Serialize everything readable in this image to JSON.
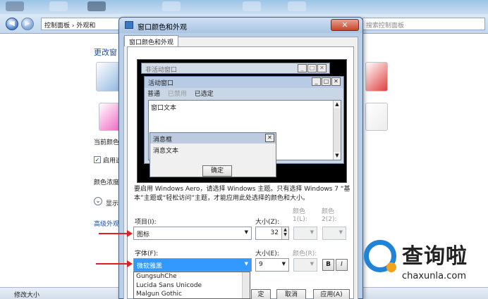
{
  "explorer": {
    "address": "控制面板 › 外观和",
    "search_placeholder": "搜索控制面板",
    "heading": "更改窗",
    "current_color_label": "当前颜色",
    "enable_label": "启用透",
    "color_intensity_label": "颜色浓度",
    "show_label": "显示",
    "advanced_link": "高级外观",
    "status_text": "修改大小"
  },
  "dialog": {
    "title": "窗口颜色和外观",
    "close_glyph": "✕",
    "tab": "窗口颜色和外观",
    "preview": {
      "inactive_title": "非活动窗口",
      "active_title": "活动窗口",
      "menu_normal": "普通",
      "menu_disabled": "已禁用",
      "menu_selected": "已选定",
      "window_text": "窗口文本",
      "msgbox_title": "消息框",
      "msgbox_text": "消息文本",
      "ok_label": "确定"
    },
    "description": "要启用 Windows Aero，请选择 Windows 主题。只有选择 Windows 7 “基本”主题或“轻松访问”主题，才能应用此处选择的颜色和大小。",
    "item_label": "项目(I):",
    "item_value": "图标",
    "size_label": "大小(Z):",
    "size_value": "32",
    "color1_label": "颜色 1(L):",
    "color2_label": "颜色 2(2):",
    "font_label": "字体(F):",
    "font_value": "微软雅黑",
    "font_size_label": "大小(E):",
    "font_size_value": "9",
    "font_color_label": "颜色(R):",
    "bold_label": "B",
    "italic_label": "I",
    "font_options": [
      "GungsuhChe",
      "Lucida Sans Unicode",
      "Malgun Gothic"
    ],
    "ok_button": "定",
    "cancel_button": "取消",
    "apply_button": "应用(A)"
  },
  "watermark": {
    "text": "查询啦",
    "url": "chaxunla.com"
  }
}
